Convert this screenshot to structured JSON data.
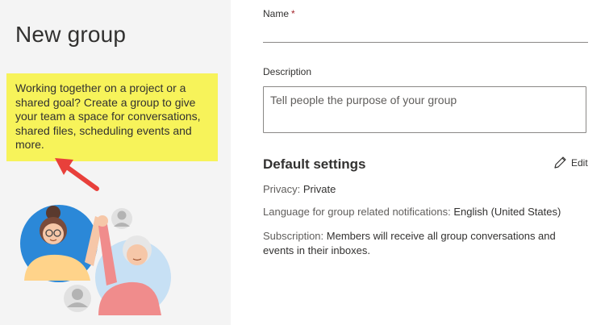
{
  "panel": {
    "title": "New group",
    "intro": "Working together on a project or a shared goal? Create a group to give your team a space for conversations, shared files, scheduling events and more."
  },
  "form": {
    "name_label": "Name",
    "required_mark": "*",
    "name_value": "",
    "description_label": "Description",
    "description_placeholder": "Tell people the purpose of your group"
  },
  "settings": {
    "heading": "Default settings",
    "edit_label": "Edit",
    "privacy_label": "Privacy:",
    "privacy_value": "Private",
    "language_label": "Language for group related notifications:",
    "language_value": "English (United States)",
    "subscription_label": "Subscription:",
    "subscription_value": "Members will receive all group conversations and events in their inboxes."
  },
  "colors": {
    "highlight": "#f7f35a",
    "arrow": "#e8403b",
    "panel_bg": "#f4f4f4"
  }
}
